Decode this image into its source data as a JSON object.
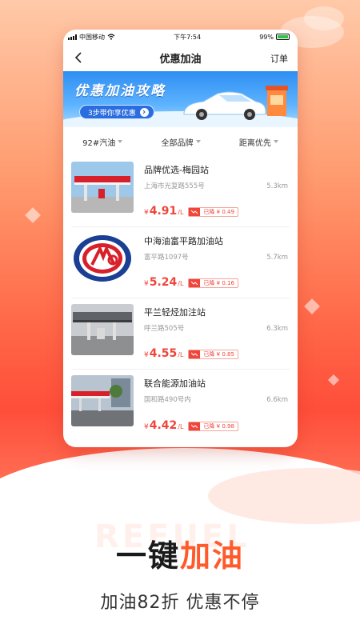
{
  "status_bar": {
    "carrier": "中国移动",
    "time": "下午7:54",
    "battery": "99%"
  },
  "nav": {
    "title": "优惠加油",
    "orders_label": "订单"
  },
  "banner": {
    "title": "优惠加油攻略",
    "button_label": "3步带你享优惠"
  },
  "filters": [
    {
      "label": "92#汽油"
    },
    {
      "label": "全部品牌"
    },
    {
      "label": "距离优先"
    }
  ],
  "stations": [
    {
      "name": "品牌优选-梅园站",
      "address": "上海市光复路555号",
      "distance": "5.3km",
      "price_symbol": "¥",
      "price": "4.91",
      "unit": "/L",
      "drop": "已降 ¥ 0.49"
    },
    {
      "name": "中海油富平路加油站",
      "address": "富平路1097号",
      "distance": "5.7km",
      "price_symbol": "¥",
      "price": "5.24",
      "unit": "/L",
      "drop": "已降 ¥ 0.16"
    },
    {
      "name": "平兰轻烃加注站",
      "address": "呼兰路505号",
      "distance": "6.3km",
      "price_symbol": "¥",
      "price": "4.55",
      "unit": "/L",
      "drop": "已降 ¥ 0.85"
    },
    {
      "name": "联合能源加油站",
      "address": "国和路490号内",
      "distance": "6.6km",
      "price_symbol": "¥",
      "price": "4.42",
      "unit": "/L",
      "drop": "已降 ¥ 0.98"
    }
  ],
  "promo": {
    "watermark": "REFUEL",
    "headline_part1": "一键",
    "headline_part2": "加油",
    "subline": "加油82折 优惠不停"
  },
  "colors": {
    "accent": "#ff5a2c",
    "price": "#f0453a",
    "banner_blue": "#2e8ef2"
  }
}
